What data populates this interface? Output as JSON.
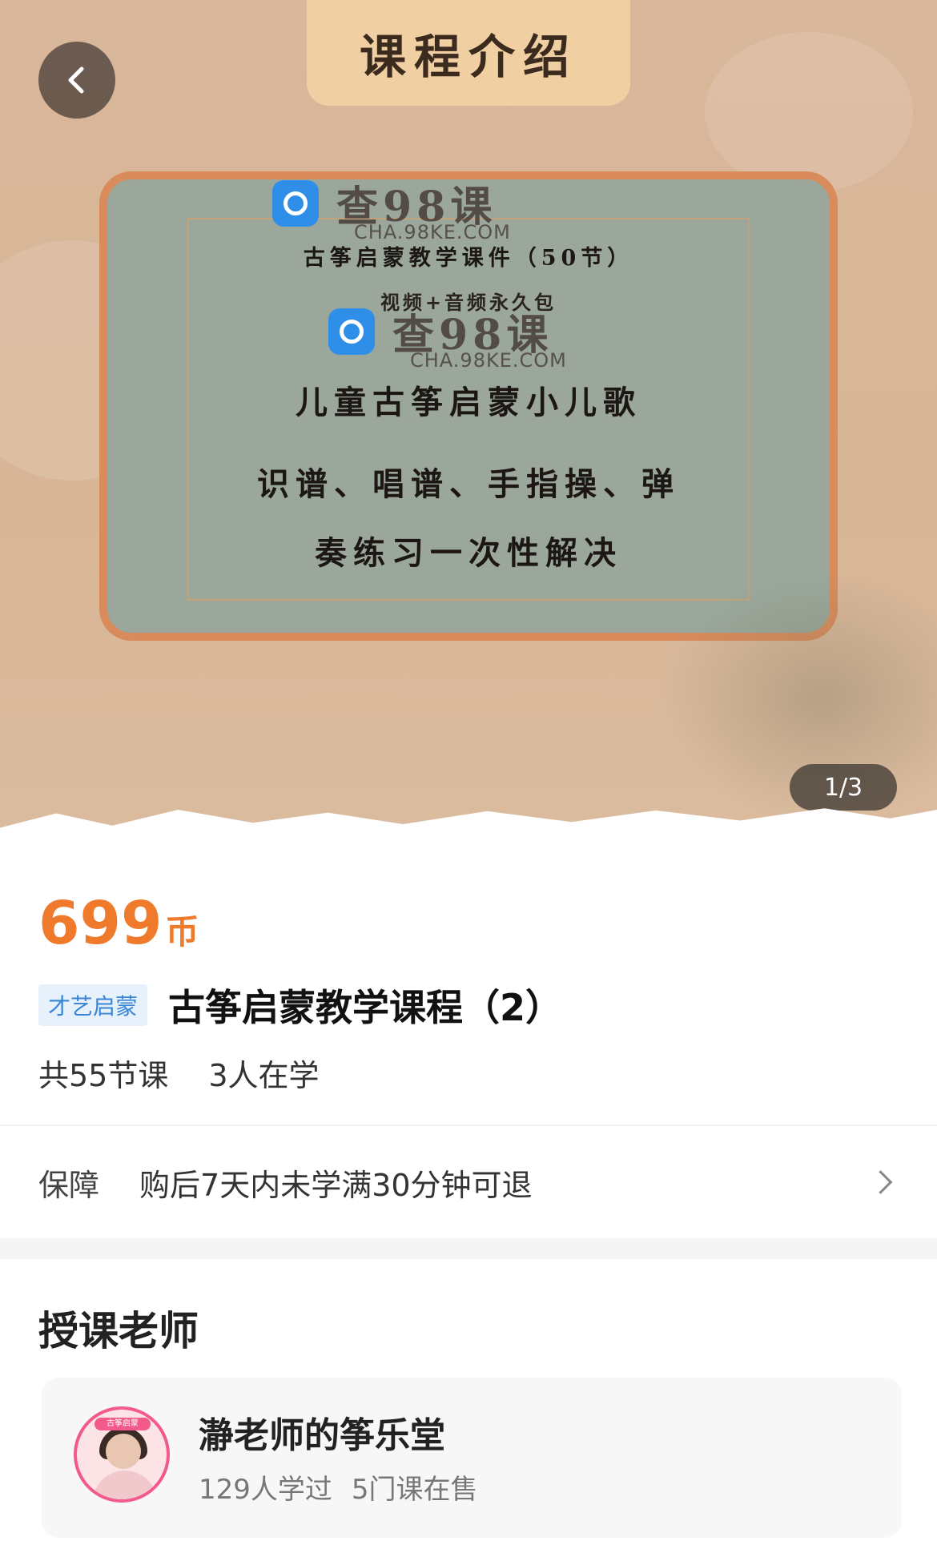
{
  "banner": {
    "plaque_title": "课程介绍",
    "watermark_name": "查98课",
    "watermark_domain": "CHA.98KE.COM",
    "line1": "古筝启蒙教学课件（50节）",
    "line2": "视频+音频永久包",
    "line3": "儿童古筝启蒙小儿歌",
    "line4": "识谱、唱谱、手指操、弹",
    "line5": "奏练习一次性解决",
    "counter": "1/3"
  },
  "course": {
    "price": "699",
    "price_unit": "币",
    "tag": "才艺启蒙",
    "title": "古筝启蒙教学课程（2）",
    "lessons": "共55节课",
    "learners": "3人在学"
  },
  "guarantee": {
    "label": "保障",
    "text": "购后7天内未学满30分钟可退"
  },
  "teacher_section": {
    "title": "授课老师",
    "name": "瀞老师的筝乐堂",
    "learned": "129人学过",
    "courses": "5门课在售",
    "avatar_badge": "古筝启蒙"
  },
  "colors": {
    "price": "#f07a2c",
    "tag_bg": "#e6f1fb",
    "tag_text": "#3a85d6",
    "avatar_ring": "#f15a8a"
  }
}
